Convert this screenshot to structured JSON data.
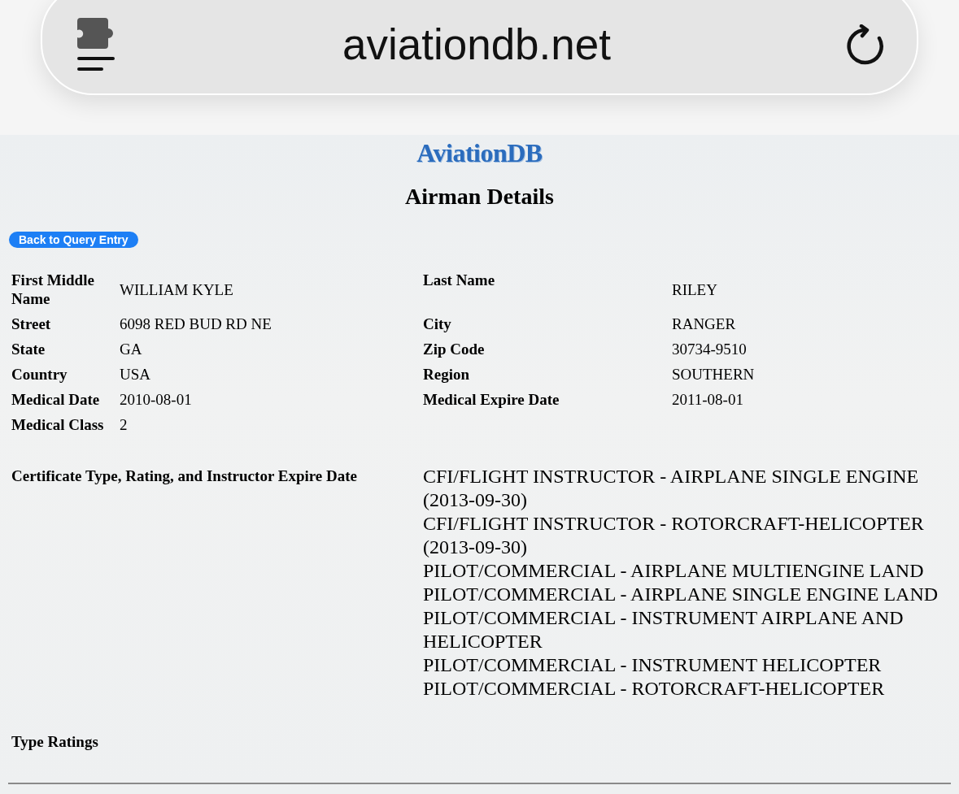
{
  "browser": {
    "url": "aviationdb.net"
  },
  "header": {
    "logo": "AviationDB",
    "title": "Airman Details"
  },
  "back_button": {
    "label": "Back to Query Entry"
  },
  "details": [
    {
      "left": {
        "label": "First Middle Name",
        "value": "WILLIAM KYLE"
      },
      "right": {
        "label": "Last Name",
        "value": "RILEY"
      }
    },
    {
      "left": {
        "label": "Street",
        "value": "6098 RED BUD RD NE"
      },
      "right": {
        "label": "City",
        "value": "RANGER"
      }
    },
    {
      "left": {
        "label": "State",
        "value": "GA"
      },
      "right": {
        "label": "Zip Code",
        "value": "30734-9510"
      }
    },
    {
      "left": {
        "label": "Country",
        "value": "USA"
      },
      "right": {
        "label": "Region",
        "value": "SOUTHERN"
      }
    },
    {
      "left": {
        "label": "Medical Date",
        "value": "2010-08-01"
      },
      "right": {
        "label": "Medical Expire Date",
        "value": "2011-08-01"
      }
    },
    {
      "left": {
        "label": "Medical Class",
        "value": "2"
      }
    }
  ],
  "certificates": {
    "label": "Certificate Type, Rating, and Instructor Expire Date",
    "items": [
      "CFI/FLIGHT INSTRUCTOR - AIRPLANE SINGLE ENGINE (2013-09-30)",
      "CFI/FLIGHT INSTRUCTOR - ROTORCRAFT-HELICOPTER (2013-09-30)",
      "PILOT/COMMERCIAL - AIRPLANE MULTIENGINE LAND",
      "PILOT/COMMERCIAL - AIRPLANE SINGLE ENGINE LAND",
      "PILOT/COMMERCIAL - INSTRUMENT AIRPLANE AND HELICOPTER",
      "PILOT/COMMERCIAL - INSTRUMENT HELICOPTER",
      "PILOT/COMMERCIAL - ROTORCRAFT-HELICOPTER"
    ]
  },
  "type_ratings": {
    "label": "Type Ratings"
  }
}
